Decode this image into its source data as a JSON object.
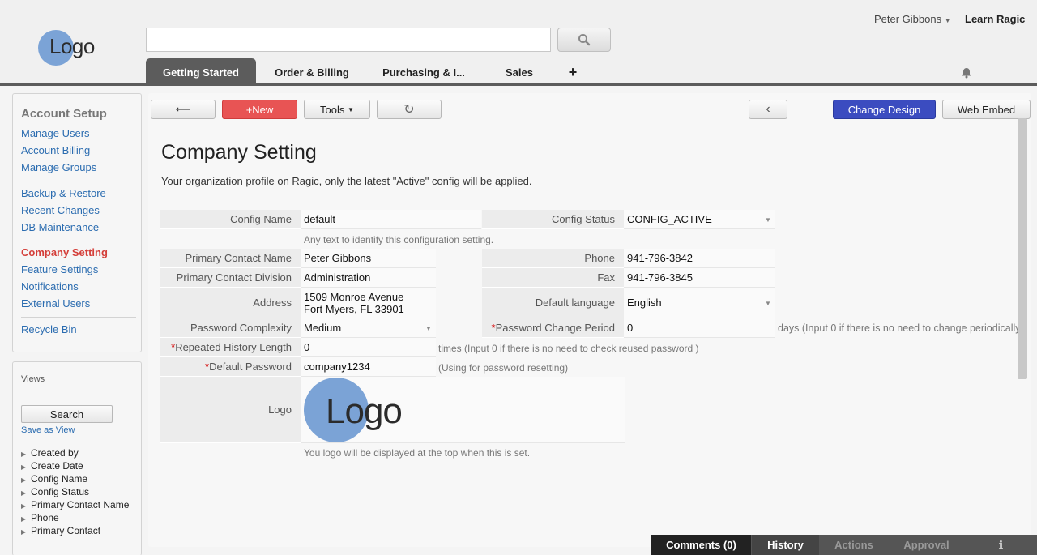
{
  "header": {
    "logo_text": "Logo",
    "search": {
      "value": "",
      "placeholder": ""
    },
    "user_name": "Peter Gibbons",
    "learn_link": "Learn Ragic",
    "tabs": [
      "Getting Started",
      "Order & Billing",
      "Purchasing & I...",
      "Sales",
      "+"
    ]
  },
  "sidebar": {
    "heading": "Account Setup",
    "links": [
      "Manage Users",
      "Account Billing",
      "Manage Groups",
      "Backup & Restore",
      "Recent Changes",
      "DB Maintenance",
      "Company Setting",
      "Feature Settings",
      "Notifications",
      "External Users",
      "Recycle Bin"
    ],
    "active": "Company Setting",
    "views": {
      "heading": "Views",
      "search_label": "Search",
      "save_as_view": "Save as View",
      "fields": [
        "Created by",
        "Create Date",
        "Config Name",
        "Config Status",
        "Primary Contact Name",
        "Phone",
        "Primary Contact"
      ]
    }
  },
  "toolbar": {
    "back_label": "⟵",
    "new_label": "+New",
    "tools_label": "Tools",
    "refresh_label": "↻",
    "prev_label": "‹",
    "change_design_label": "Change Design",
    "web_embed_label": "Web Embed"
  },
  "page": {
    "title": "Company Setting",
    "description": "Your organization profile on Ragic, only the latest \"Active\" config will be applied."
  },
  "form": {
    "config_name": {
      "label": "Config Name",
      "value": "default",
      "hint": "Any text to identify this configuration setting."
    },
    "config_status": {
      "label": "Config Status",
      "value": "CONFIG_ACTIVE"
    },
    "primary_contact_name": {
      "label": "Primary Contact Name",
      "value": "Peter Gibbons"
    },
    "phone": {
      "label": "Phone",
      "value": "941-796-3842"
    },
    "primary_contact_division": {
      "label": "Primary Contact Division",
      "value": "Administration"
    },
    "fax": {
      "label": "Fax",
      "value": "941-796-3845"
    },
    "address": {
      "label": "Address",
      "line1": "1509 Monroe Avenue",
      "line2": "Fort Myers, FL 33901"
    },
    "default_language": {
      "label": "Default language",
      "value": "English"
    },
    "password_complexity": {
      "label": "Password Complexity",
      "value": "Medium"
    },
    "password_change_period": {
      "label": "Password Change Period",
      "value": "0",
      "hint": "days (Input 0 if there is no need to change periodically"
    },
    "repeated_history_length": {
      "label": "Repeated History Length",
      "value": "0",
      "hint": "times (Input 0 if there is no need to check reused password )"
    },
    "default_password": {
      "label": "Default Password",
      "value": "company1234",
      "hint": "(Using for password resetting)"
    },
    "logo": {
      "label": "Logo",
      "image_text": "Logo",
      "hint": "You logo will be displayed at the top when this is set."
    },
    "required_mark": "*"
  },
  "bottom_bar": {
    "comments": "Comments (0)",
    "history": "History",
    "actions": "Actions",
    "approval": "Approval",
    "info_icon": "ℹ"
  },
  "colors": {
    "brand_logo": "#7ba3d6",
    "new_button": "#e85454",
    "change_design": "#3b4cc0",
    "active_link": "#d43f3a",
    "link": "#2b6cb0"
  }
}
